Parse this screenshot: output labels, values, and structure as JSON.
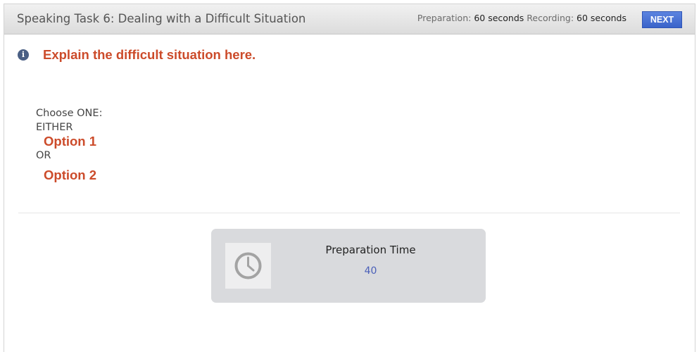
{
  "header": {
    "title": "Speaking Task 6: Dealing with a Difficult Situation",
    "preparation_label": "Preparation:",
    "preparation_value": "60 seconds",
    "recording_label": "Recording:",
    "recording_value": "60 seconds",
    "next_label": "NEXT"
  },
  "instructions": {
    "icon": "info-icon",
    "icon_glyph": "i",
    "text": "Explain the difficult situation here."
  },
  "choices": {
    "prompt": "Choose ONE:",
    "either": "EITHER",
    "option1": "Option 1",
    "or": "OR",
    "option2": "Option 2"
  },
  "timer": {
    "icon": "clock-icon",
    "label": "Preparation Time",
    "value": "40"
  },
  "colors": {
    "accent_red": "#cc4b2a",
    "button_blue": "#3a63c9",
    "timer_value_blue": "#4a5fb8"
  }
}
